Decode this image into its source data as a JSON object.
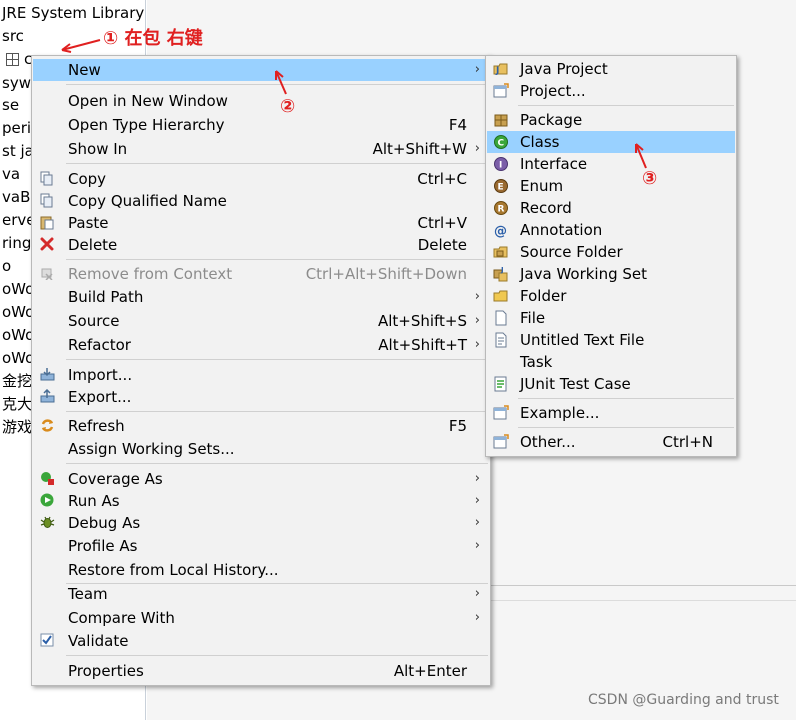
{
  "tree": {
    "rows": [
      "JRE System Library",
      "src",
      "c",
      "syw",
      "se",
      "perin",
      "st ja",
      "va",
      "vaBu",
      "erver",
      "ring",
      "o",
      "oWo",
      "oWo",
      "oWo",
      "oWo",
      "金挖",
      "克大",
      "游戏"
    ]
  },
  "main_menu": {
    "new_label": "New",
    "open_new_window": "Open in New Window",
    "open_type_hierarchy": "Open Type Hierarchy",
    "open_type_hierarchy_sc": "F4",
    "show_in": "Show In",
    "show_in_sc": "Alt+Shift+W",
    "copy": "Copy",
    "copy_sc": "Ctrl+C",
    "copy_qualified": "Copy Qualified Name",
    "paste": "Paste",
    "paste_sc": "Ctrl+V",
    "delete": "Delete",
    "delete_sc": "Delete",
    "remove_context": "Remove from Context",
    "remove_context_sc": "Ctrl+Alt+Shift+Down",
    "build_path": "Build Path",
    "source": "Source",
    "source_sc": "Alt+Shift+S",
    "refactor": "Refactor",
    "refactor_sc": "Alt+Shift+T",
    "import": "Import...",
    "export": "Export...",
    "refresh": "Refresh",
    "refresh_sc": "F5",
    "assign_ws": "Assign Working Sets...",
    "coverage_as": "Coverage As",
    "run_as": "Run As",
    "debug_as": "Debug As",
    "profile_as": "Profile As",
    "restore_history": "Restore from Local History...",
    "team": "Team",
    "compare_with": "Compare With",
    "validate": "Validate",
    "properties": "Properties",
    "properties_sc": "Alt+Enter",
    "arrow": "›"
  },
  "sub_menu": {
    "java_project": "Java Project",
    "project": "Project...",
    "package": "Package",
    "class": "Class",
    "interface": "Interface",
    "enum": "Enum",
    "record": "Record",
    "annotation": "Annotation",
    "source_folder": "Source Folder",
    "java_working_set": "Java Working Set",
    "folder": "Folder",
    "file": "File",
    "untitled_text_file": "Untitled Text File",
    "task": "Task",
    "junit_test_case": "JUnit Test Case",
    "example": "Example...",
    "other": "Other...",
    "other_sc": "Ctrl+N"
  },
  "annotations": {
    "step1": "① 在包 右键",
    "step2": "②",
    "step3": "③"
  },
  "watermark": "CSDN @Guarding and trust",
  "colors": {
    "highlight": "#99d1ff",
    "menu_bg": "#f2f2f2",
    "annotation": "#e02020"
  }
}
